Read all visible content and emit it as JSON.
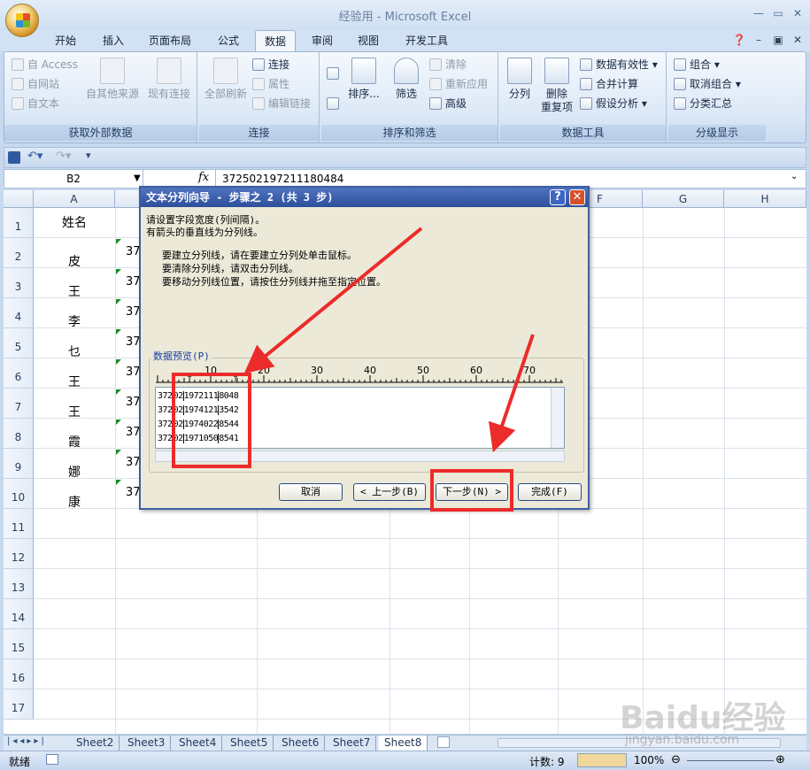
{
  "window": {
    "title": "经验用 - Microsoft Excel"
  },
  "tabs": [
    "开始",
    "插入",
    "页面布局",
    "公式",
    "数据",
    "审阅",
    "视图",
    "开发工具"
  ],
  "active_tab": "数据",
  "ribbon": {
    "get_external": {
      "title": "获取外部数据",
      "access": "自 Access",
      "web": "自网站",
      "text": "自文本",
      "other": "自其他来源",
      "existing": "现有连接"
    },
    "connections": {
      "title": "连接",
      "refresh_all": "全部刷新",
      "connections": "连接",
      "properties": "属性",
      "edit_links": "编辑链接"
    },
    "sort_filter": {
      "title": "排序和筛选",
      "sort": "排序...",
      "filter": "筛选",
      "clear": "清除",
      "reapply": "重新应用",
      "advanced": "高级"
    },
    "data_tools": {
      "title": "数据工具",
      "text_to_columns": "分列",
      "remove_dup_1": "删除",
      "remove_dup_2": "重复项",
      "validation": "数据有效性",
      "consolidate": "合并计算",
      "what_if": "假设分析"
    },
    "outline": {
      "title": "分级显示",
      "group": "组合",
      "ungroup": "取消组合",
      "subtotal": "分类汇总"
    }
  },
  "formula_bar": {
    "name_box": "B2",
    "fx": "fx",
    "value": "372502197211180484"
  },
  "columns": [
    "A",
    "B",
    "C",
    "D",
    "E",
    "F",
    "G",
    "H"
  ],
  "rows": [
    "1",
    "2",
    "3",
    "4",
    "5",
    "6",
    "7",
    "8",
    "9",
    "10",
    "11",
    "12",
    "13",
    "14",
    "15",
    "16",
    "17"
  ],
  "cells_a": [
    "姓名",
    "皮",
    "王",
    "李",
    "乜",
    "王",
    "王",
    "霞",
    "娜",
    "康"
  ],
  "cells_b_prefix": "37",
  "dialog": {
    "title": "文本分列向导 - 步骤之 2 (共 3 步)",
    "help": "?",
    "close": "✕",
    "line1": "请设置字段宽度(列间隔)。",
    "line2": "有箭头的垂直线为分列线。",
    "bullet1": "要建立分列线，请在要建立分列处单击鼠标。",
    "bullet2": "要清除分列线，请双击分列线。",
    "bullet3": "要移动分列线位置，请按住分列线并拖至指定位置。",
    "preview_label": "数据预览(P)",
    "ruler_labels": [
      "10",
      "20",
      "30",
      "40",
      "50",
      "60",
      "70"
    ],
    "preview_rows": [
      [
        "372",
        "02",
        "1972111",
        "8048"
      ],
      [
        "372",
        "02",
        "1974121",
        "3542"
      ],
      [
        "372",
        "02",
        "1974022",
        "8544"
      ],
      [
        "372",
        "02",
        "1971050",
        "8541"
      ]
    ],
    "buttons": {
      "cancel": "取消",
      "back": "< 上一步(B)",
      "next": "下一步(N) >",
      "finish": "完成(F)"
    }
  },
  "sheet_tabs": [
    "Sheet2",
    "Sheet3",
    "Sheet4",
    "Sheet5",
    "Sheet6",
    "Sheet7",
    "Sheet8"
  ],
  "active_sheet": "Sheet8",
  "status": {
    "ready": "就绪",
    "count": "计数: 9",
    "zoom": "100%"
  },
  "watermark": {
    "brand": "Baidu经验",
    "url": "jingyan.baidu.com"
  },
  "colors": {
    "annotation": "#ec2b2b",
    "dialog_title": "#2e4f9a"
  }
}
